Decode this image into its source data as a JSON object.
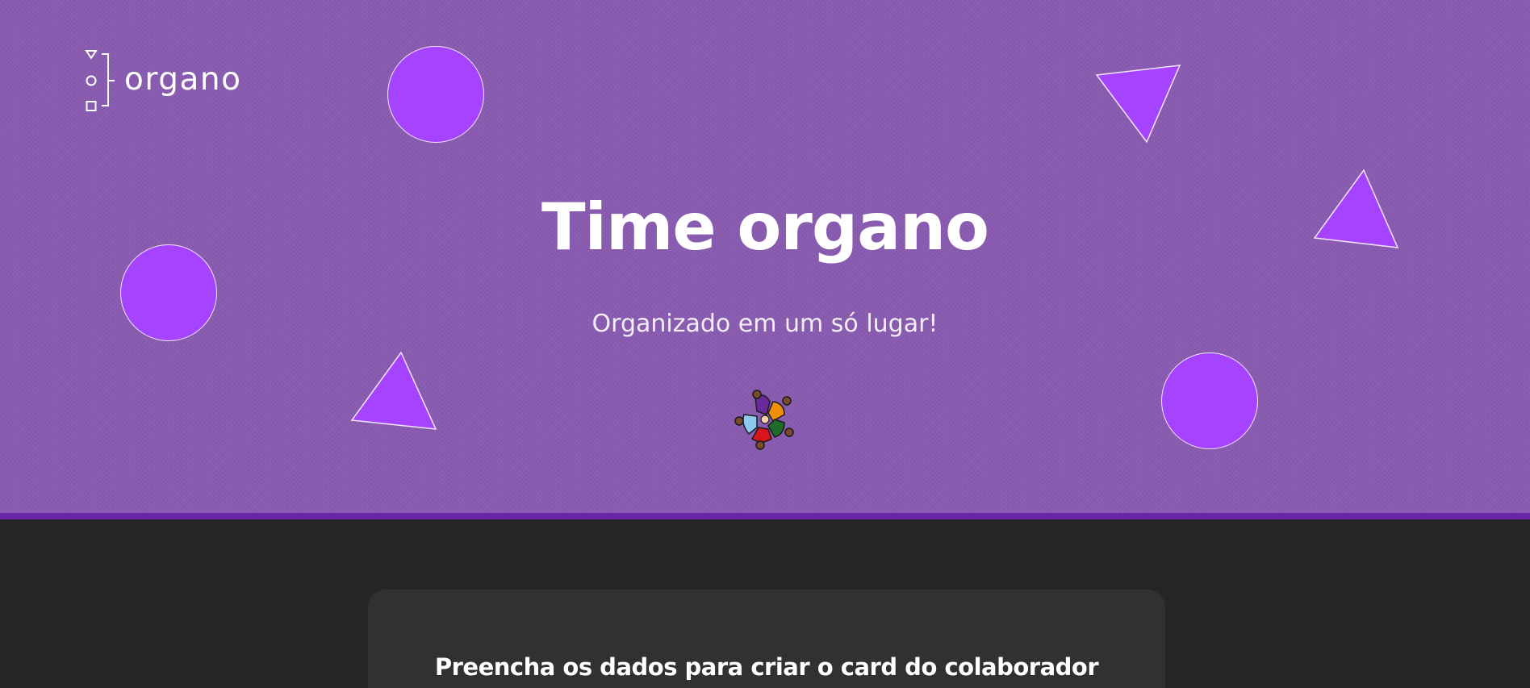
{
  "header": {
    "logo_text": "organo",
    "title": "Time organo",
    "subtitle": "Organizado em um só lugar!"
  },
  "form": {
    "title": "Preencha os dados para criar o card do colaborador"
  },
  "colors": {
    "hero_background": "#8a5cb2",
    "hero_border": "#6b25a8",
    "shape_fill": "#a543ff",
    "page_background": "#262626",
    "card_background": "#313131"
  },
  "icons": {
    "logo": "organo-logo-icon",
    "team": "team-circle-icon"
  }
}
